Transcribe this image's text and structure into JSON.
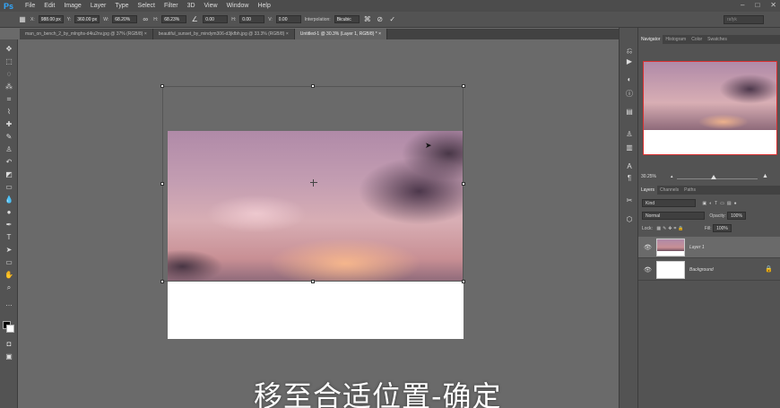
{
  "app": {
    "logo": "Ps",
    "window_controls": [
      "–",
      "□",
      "✕"
    ]
  },
  "menu": [
    "File",
    "Edit",
    "Image",
    "Layer",
    "Type",
    "Select",
    "Filter",
    "3D",
    "View",
    "Window",
    "Help"
  ],
  "options": {
    "x_label": "X:",
    "x_value": "988.00 px",
    "y_label": "Y:",
    "y_value": "360.00 px",
    "w_label": "W:",
    "w_value": "68.20%",
    "h_label": "H:",
    "h_value": "68.23%",
    "angle_value": "0.00",
    "h_skew_label": "H:",
    "h_skew_value": "0.00",
    "v_skew_label": "V:",
    "v_skew_value": "0.00",
    "interp_label": "Interpolation:",
    "interp_value": "Bicubic",
    "search_placeholder": "rafyk"
  },
  "tabs": [
    "man_on_bench_2_by_mlnghs-d4iu2nv.jpg @ 37% (RGB/8) ×",
    "beautiful_sunset_by_mindym306-d3jkfbh.jpg @ 33.3% (RGB/8) ×",
    "Untitled-1 @ 30.3% (Layer 1, RGB/8) * ×"
  ],
  "subtitle": "移至合适位置-确定",
  "navigator": {
    "tabs": [
      "Navigator",
      "Histogram",
      "Color",
      "Swatches"
    ],
    "zoom": "30.25%"
  },
  "layers": {
    "tabs": [
      "Layers",
      "Channels",
      "Paths"
    ],
    "kind_label": "Kind",
    "blend_mode": "Normal",
    "opacity_label": "Opacity:",
    "opacity_value": "100%",
    "lock_label": "Lock:",
    "fill_label": "Fill:",
    "fill_value": "100%",
    "items": [
      {
        "name": "Layer 1",
        "selected": true
      },
      {
        "name": "Background",
        "selected": false
      }
    ]
  }
}
